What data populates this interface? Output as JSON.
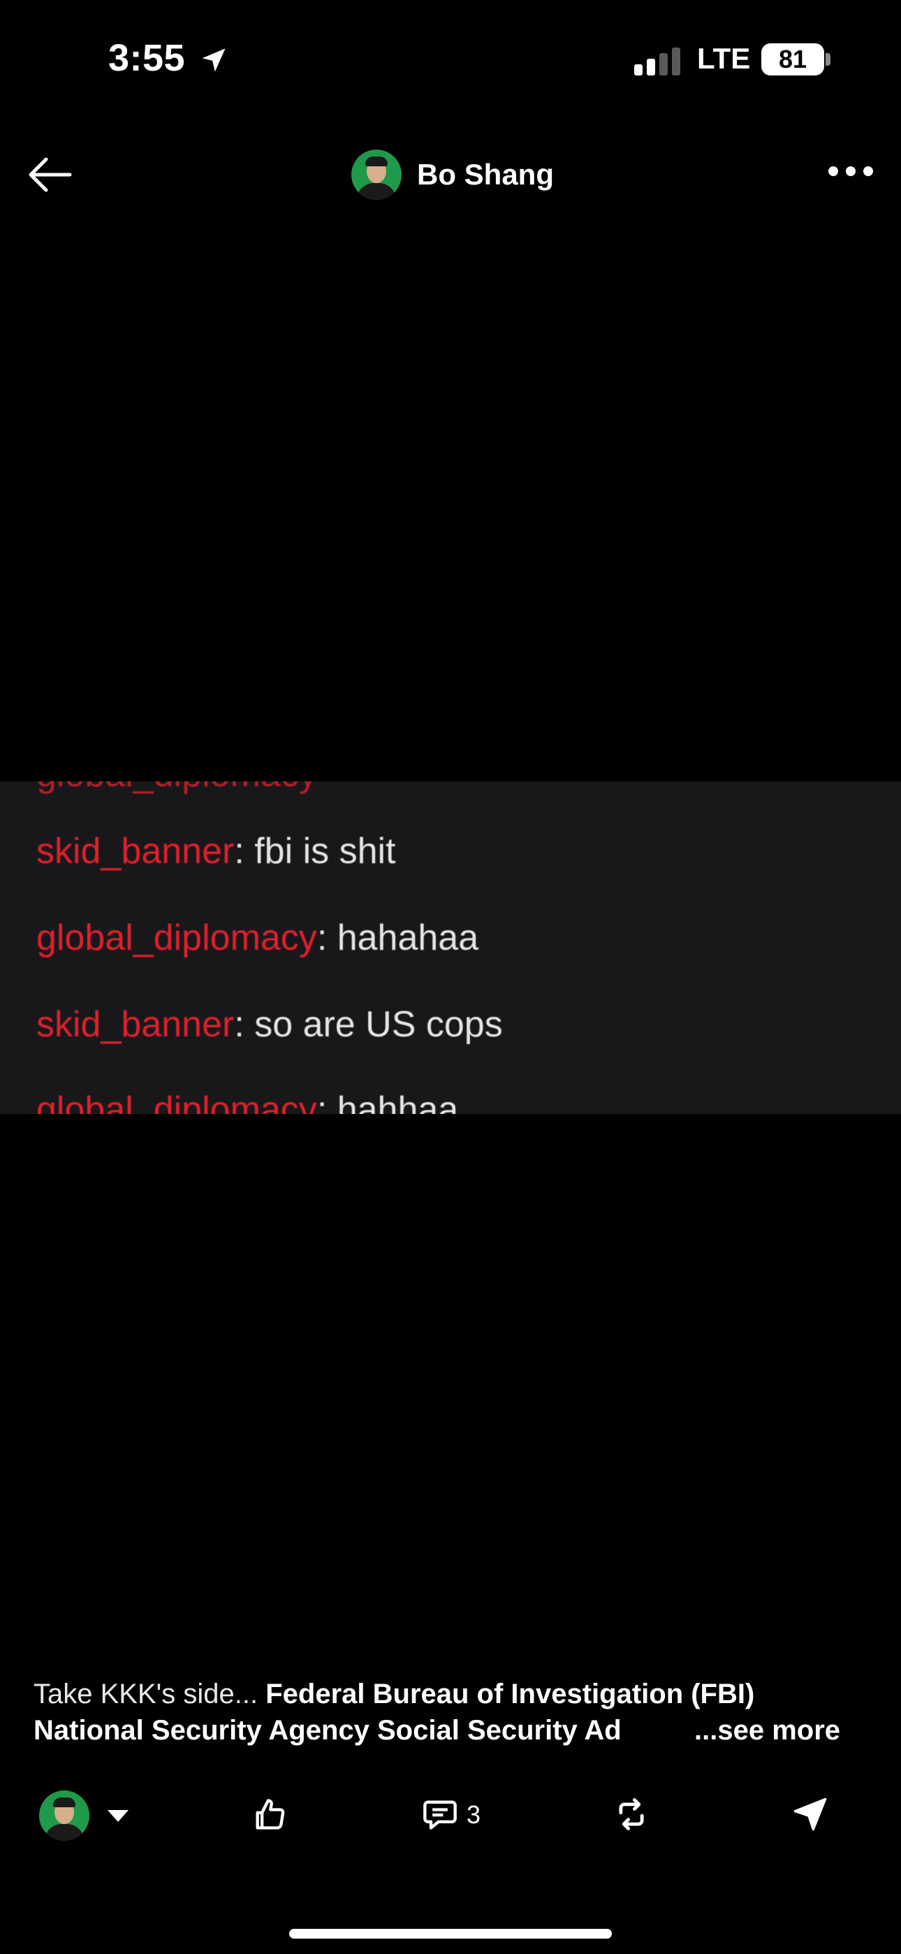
{
  "status_bar": {
    "time": "3:55",
    "network": "LTE",
    "battery": "81",
    "location_icon": "location-arrow-icon",
    "signal_icon": "cellular-signal-icon"
  },
  "header": {
    "author_name": "Bo Shang",
    "back_icon": "arrow-left-icon",
    "more_icon": "more-horizontal-icon"
  },
  "media": {
    "chat_lines": [
      {
        "user": "skid_banner",
        "message": ": fbi is shit"
      },
      {
        "user": "global_diplomacy",
        "message": ": hahahaa"
      },
      {
        "user": "skid_banner",
        "message": ": so are US cops"
      },
      {
        "user": "global_diplomacy",
        "message": ": hahhaa"
      }
    ]
  },
  "caption": {
    "lead": "Take KKK's side... ",
    "line1_bold": "Federal Bureau of Investigation (FBI)",
    "line2_bold": "National Security Agency Social Security Ad",
    "see_more": "...see more"
  },
  "actions": {
    "comment_count": "3",
    "icons": [
      "like-icon",
      "comment-icon",
      "repost-icon",
      "send-icon"
    ]
  },
  "colors": {
    "background": "#000000",
    "chat_username": "#e0202c",
    "chat_panel": "#18181b"
  }
}
